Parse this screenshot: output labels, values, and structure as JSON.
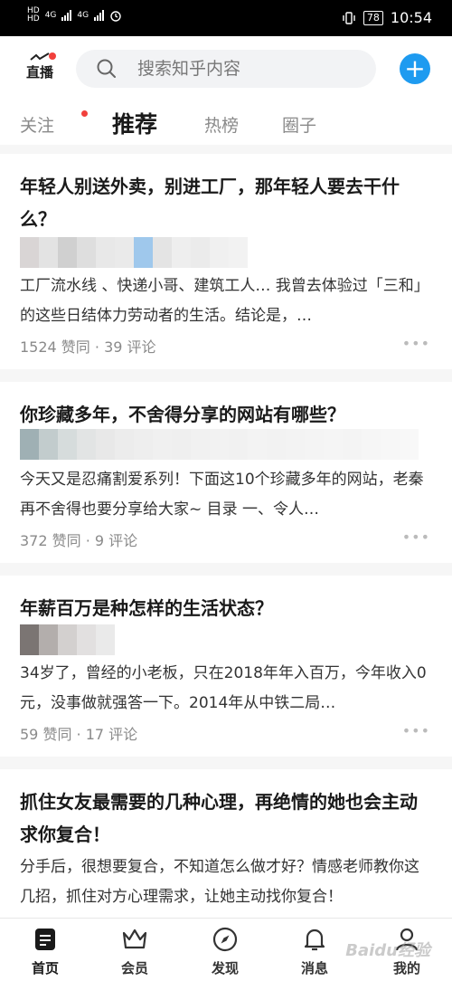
{
  "status_bar": {
    "left_tags": [
      "HD",
      "HD"
    ],
    "network": [
      "4G",
      "4G"
    ],
    "battery": "78",
    "time": "10:54"
  },
  "header": {
    "live_label": "直播",
    "search_placeholder": "搜索知乎内容",
    "add_label": "+"
  },
  "tabs": [
    {
      "label": "关注"
    },
    {
      "label": "推荐"
    },
    {
      "label": "热榜"
    },
    {
      "label": "圈子"
    }
  ],
  "feed": [
    {
      "title": "年轻人别送外卖，别进工厂，那年轻人要去干什么？",
      "excerpt": "工厂流水线 、快递小哥、建筑工人… 我曾去体验过「三和」的这些日结体力劳动者的生活。结论是，…",
      "meta": "1524 赞同 · 39 评论"
    },
    {
      "title": "你珍藏多年，不舍得分享的网站有哪些？",
      "excerpt": "今天又是忍痛割爱系列！下面这10个珍藏多年的网站，老秦再不舍得也要分享给大家~ 目录 一、令人…",
      "meta": "372 赞同 · 9 评论"
    },
    {
      "title": "年薪百万是种怎样的生活状态？",
      "excerpt": "34岁了，曾经的小老板，只在2018年年入百万，今年收入0元，没事做就强答一下。2014年从中铁二局…",
      "meta": "59 赞同 · 17 评论"
    },
    {
      "title": "抓住女友最需要的几种心理，再绝情的她也会主动求你复合！",
      "excerpt": "分手后，很想要复合，不知道怎么做才好？情感老师教你这几招，抓住对方心理需求，让她主动找你复合！",
      "meta": ""
    }
  ],
  "more_label": "•••",
  "bottom_nav": [
    {
      "label": "首页",
      "icon": "home-icon"
    },
    {
      "label": "会员",
      "icon": "crown-icon"
    },
    {
      "label": "发现",
      "icon": "compass-icon"
    },
    {
      "label": "消息",
      "icon": "bell-icon"
    },
    {
      "label": "我的",
      "icon": "person-icon"
    }
  ],
  "watermark": "Baidu经验"
}
